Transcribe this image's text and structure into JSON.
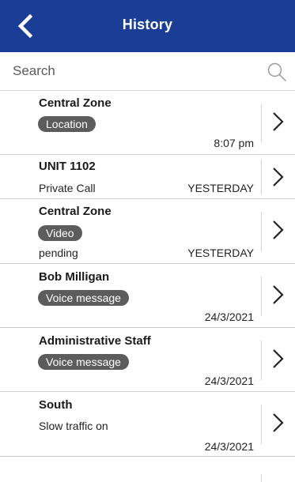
{
  "header": {
    "title": "History"
  },
  "search": {
    "placeholder": "Search"
  },
  "items": [
    {
      "title": "Central Zone",
      "badge": "Location",
      "subtitle": "",
      "time": "8:07 pm"
    },
    {
      "title": "UNIT 1102",
      "badge": "",
      "subtitle": "Private Call",
      "time": "YESTERDAY"
    },
    {
      "title": "Central Zone",
      "badge": "Video",
      "subtitle": "pending",
      "time": "YESTERDAY"
    },
    {
      "title": "Bob Milligan",
      "badge": "Voice message",
      "subtitle": "",
      "time": "24/3/2021"
    },
    {
      "title": "Administrative Staff",
      "badge": "Voice message",
      "subtitle": "",
      "time": "24/3/2021"
    },
    {
      "title": "South",
      "badge": "",
      "subtitle": "Slow traffic on",
      "time": "24/3/2021"
    }
  ],
  "colors": {
    "header_bg": "#1a3d95",
    "badge_bg": "#5c5c5c"
  }
}
